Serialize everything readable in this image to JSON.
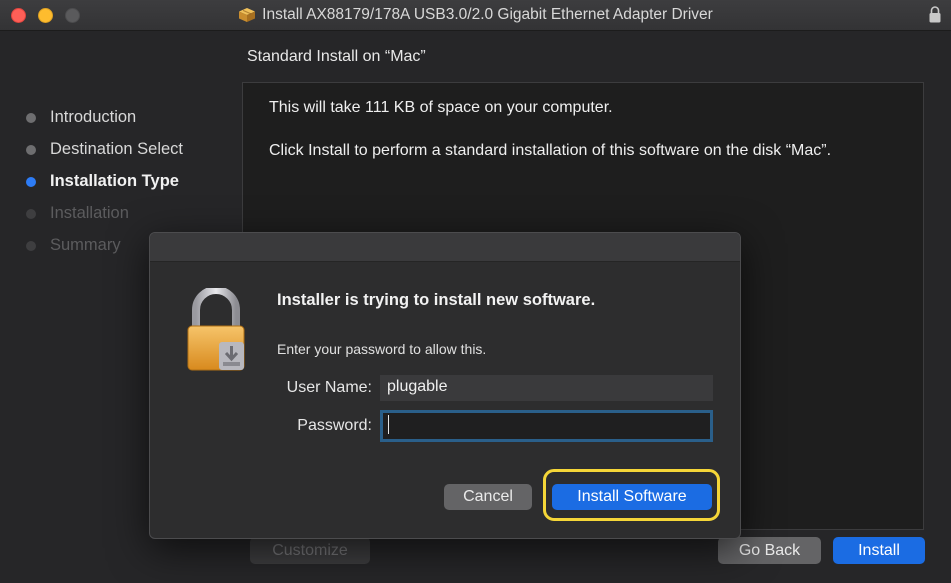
{
  "window": {
    "title": "Install AX88179/178A USB3.0/2.0 Gigabit Ethernet Adapter Driver",
    "title_icon": "package-icon",
    "lock_icon": "lock-icon"
  },
  "installer": {
    "subtitle": "Standard Install on “Mac”",
    "steps": [
      {
        "label": "Introduction",
        "state": "done"
      },
      {
        "label": "Destination Select",
        "state": "done"
      },
      {
        "label": "Installation Type",
        "state": "current"
      },
      {
        "label": "Installation",
        "state": "future"
      },
      {
        "label": "Summary",
        "state": "future"
      }
    ],
    "content": {
      "space_text": "This will take 111 KB of space on your computer.",
      "install_text": "Click Install to perform a standard installation of this software on the disk “Mac”."
    },
    "buttons": {
      "customize": "Customize",
      "go_back": "Go Back",
      "install": "Install"
    }
  },
  "auth_dialog": {
    "heading": "Installer is trying to install new software.",
    "info": "Enter your password to allow this.",
    "username_label": "User Name:",
    "username_value": "plugable",
    "password_label": "Password:",
    "password_value": "",
    "cancel_label": "Cancel",
    "confirm_label": "Install Software",
    "icon": "padlock-icon"
  },
  "colors": {
    "accent": "#1b6ce3",
    "highlight": "#f5d638",
    "close": "#fe5f57",
    "minimize": "#febc2e"
  }
}
